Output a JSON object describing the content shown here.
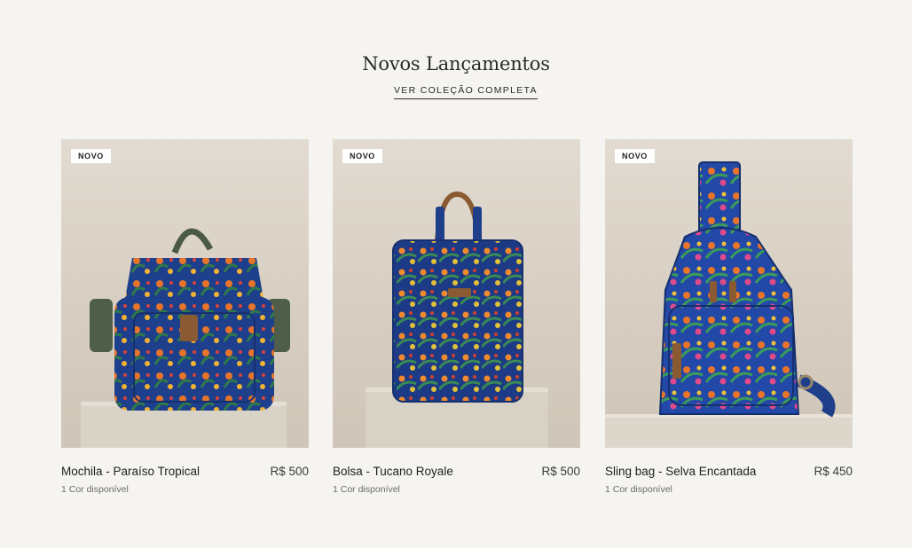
{
  "section": {
    "title": "Novos Lançamentos",
    "link_label": "VER COLEÇÃO COMPLETA"
  },
  "products": [
    {
      "badge": "NOVO",
      "name": "Mochila - Paraíso Tropical",
      "price": "R$ 500",
      "colors": "1 Cor disponível",
      "image_icon": "backpack-icon"
    },
    {
      "badge": "NOVO",
      "name": "Bolsa - Tucano Royale",
      "price": "R$ 500",
      "colors": "1 Cor disponível",
      "image_icon": "tote-bag-icon"
    },
    {
      "badge": "NOVO",
      "name": "Sling bag - Selva Encantada",
      "price": "R$ 450",
      "colors": "1 Cor disponível",
      "image_icon": "sling-bag-icon"
    }
  ],
  "colors": {
    "background": "#f6f4f1",
    "bag_navy": "#1f3f8a",
    "floral_orange": "#e8742a"
  }
}
